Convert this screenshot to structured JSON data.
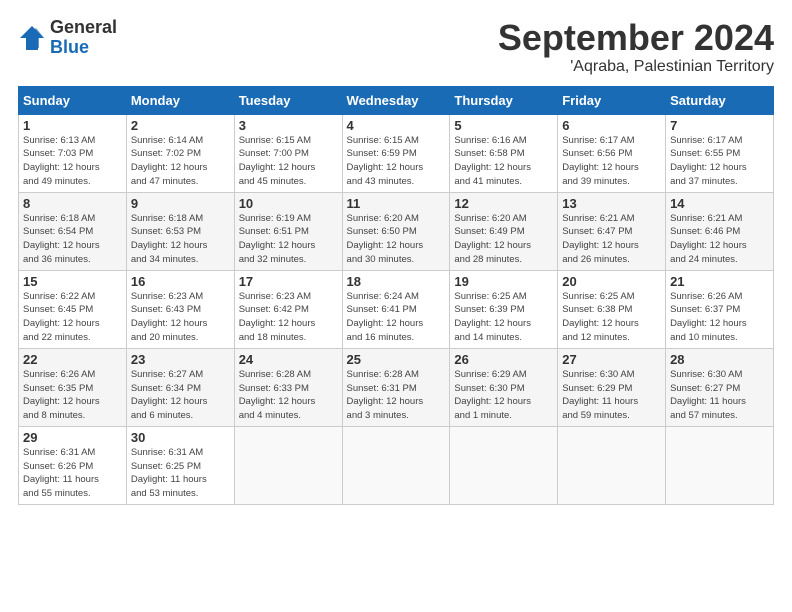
{
  "logo": {
    "general": "General",
    "blue": "Blue"
  },
  "header": {
    "month": "September 2024",
    "location": "'Aqraba, Palestinian Territory"
  },
  "weekdays": [
    "Sunday",
    "Monday",
    "Tuesday",
    "Wednesday",
    "Thursday",
    "Friday",
    "Saturday"
  ],
  "weeks": [
    [
      {
        "day": "1",
        "info": "Sunrise: 6:13 AM\nSunset: 7:03 PM\nDaylight: 12 hours\nand 49 minutes."
      },
      {
        "day": "2",
        "info": "Sunrise: 6:14 AM\nSunset: 7:02 PM\nDaylight: 12 hours\nand 47 minutes."
      },
      {
        "day": "3",
        "info": "Sunrise: 6:15 AM\nSunset: 7:00 PM\nDaylight: 12 hours\nand 45 minutes."
      },
      {
        "day": "4",
        "info": "Sunrise: 6:15 AM\nSunset: 6:59 PM\nDaylight: 12 hours\nand 43 minutes."
      },
      {
        "day": "5",
        "info": "Sunrise: 6:16 AM\nSunset: 6:58 PM\nDaylight: 12 hours\nand 41 minutes."
      },
      {
        "day": "6",
        "info": "Sunrise: 6:17 AM\nSunset: 6:56 PM\nDaylight: 12 hours\nand 39 minutes."
      },
      {
        "day": "7",
        "info": "Sunrise: 6:17 AM\nSunset: 6:55 PM\nDaylight: 12 hours\nand 37 minutes."
      }
    ],
    [
      {
        "day": "8",
        "info": "Sunrise: 6:18 AM\nSunset: 6:54 PM\nDaylight: 12 hours\nand 36 minutes."
      },
      {
        "day": "9",
        "info": "Sunrise: 6:18 AM\nSunset: 6:53 PM\nDaylight: 12 hours\nand 34 minutes."
      },
      {
        "day": "10",
        "info": "Sunrise: 6:19 AM\nSunset: 6:51 PM\nDaylight: 12 hours\nand 32 minutes."
      },
      {
        "day": "11",
        "info": "Sunrise: 6:20 AM\nSunset: 6:50 PM\nDaylight: 12 hours\nand 30 minutes."
      },
      {
        "day": "12",
        "info": "Sunrise: 6:20 AM\nSunset: 6:49 PM\nDaylight: 12 hours\nand 28 minutes."
      },
      {
        "day": "13",
        "info": "Sunrise: 6:21 AM\nSunset: 6:47 PM\nDaylight: 12 hours\nand 26 minutes."
      },
      {
        "day": "14",
        "info": "Sunrise: 6:21 AM\nSunset: 6:46 PM\nDaylight: 12 hours\nand 24 minutes."
      }
    ],
    [
      {
        "day": "15",
        "info": "Sunrise: 6:22 AM\nSunset: 6:45 PM\nDaylight: 12 hours\nand 22 minutes."
      },
      {
        "day": "16",
        "info": "Sunrise: 6:23 AM\nSunset: 6:43 PM\nDaylight: 12 hours\nand 20 minutes."
      },
      {
        "day": "17",
        "info": "Sunrise: 6:23 AM\nSunset: 6:42 PM\nDaylight: 12 hours\nand 18 minutes."
      },
      {
        "day": "18",
        "info": "Sunrise: 6:24 AM\nSunset: 6:41 PM\nDaylight: 12 hours\nand 16 minutes."
      },
      {
        "day": "19",
        "info": "Sunrise: 6:25 AM\nSunset: 6:39 PM\nDaylight: 12 hours\nand 14 minutes."
      },
      {
        "day": "20",
        "info": "Sunrise: 6:25 AM\nSunset: 6:38 PM\nDaylight: 12 hours\nand 12 minutes."
      },
      {
        "day": "21",
        "info": "Sunrise: 6:26 AM\nSunset: 6:37 PM\nDaylight: 12 hours\nand 10 minutes."
      }
    ],
    [
      {
        "day": "22",
        "info": "Sunrise: 6:26 AM\nSunset: 6:35 PM\nDaylight: 12 hours\nand 8 minutes."
      },
      {
        "day": "23",
        "info": "Sunrise: 6:27 AM\nSunset: 6:34 PM\nDaylight: 12 hours\nand 6 minutes."
      },
      {
        "day": "24",
        "info": "Sunrise: 6:28 AM\nSunset: 6:33 PM\nDaylight: 12 hours\nand 4 minutes."
      },
      {
        "day": "25",
        "info": "Sunrise: 6:28 AM\nSunset: 6:31 PM\nDaylight: 12 hours\nand 3 minutes."
      },
      {
        "day": "26",
        "info": "Sunrise: 6:29 AM\nSunset: 6:30 PM\nDaylight: 12 hours\nand 1 minute."
      },
      {
        "day": "27",
        "info": "Sunrise: 6:30 AM\nSunset: 6:29 PM\nDaylight: 11 hours\nand 59 minutes."
      },
      {
        "day": "28",
        "info": "Sunrise: 6:30 AM\nSunset: 6:27 PM\nDaylight: 11 hours\nand 57 minutes."
      }
    ],
    [
      {
        "day": "29",
        "info": "Sunrise: 6:31 AM\nSunset: 6:26 PM\nDaylight: 11 hours\nand 55 minutes."
      },
      {
        "day": "30",
        "info": "Sunrise: 6:31 AM\nSunset: 6:25 PM\nDaylight: 11 hours\nand 53 minutes."
      },
      null,
      null,
      null,
      null,
      null
    ]
  ]
}
